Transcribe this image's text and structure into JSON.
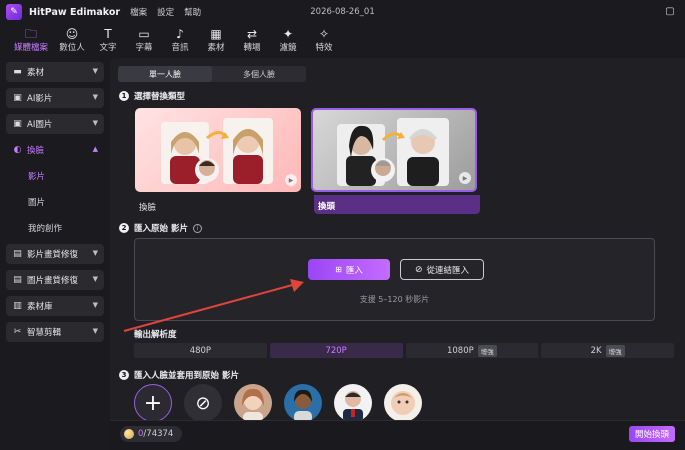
{
  "titlebar": {
    "app_title": "HitPaw Edimakor",
    "menus": [
      "檔案",
      "設定",
      "幫助"
    ],
    "doc_title": "2026-08-26_01"
  },
  "toolbar": {
    "tools": [
      {
        "label": "媒體檔案",
        "icon": "media-icon"
      },
      {
        "label": "數位人",
        "icon": "avatar-person-icon"
      },
      {
        "label": "文字",
        "icon": "text-icon"
      },
      {
        "label": "字幕",
        "icon": "subtitle-icon"
      },
      {
        "label": "音訊",
        "icon": "music-icon"
      },
      {
        "label": "素材",
        "icon": "grid-icon"
      },
      {
        "label": "轉場",
        "icon": "transition-icon"
      },
      {
        "label": "濾鏡",
        "icon": "sparkle-icon"
      },
      {
        "label": "特效",
        "icon": "effects-icon"
      }
    ]
  },
  "sidebar": {
    "items": [
      {
        "label": "素材",
        "icon": "folder-icon"
      },
      {
        "label": "AI影片",
        "icon": "ai-video-icon"
      },
      {
        "label": "AI圖片",
        "icon": "ai-image-icon"
      },
      {
        "label": "換臉",
        "icon": "face-swap-icon"
      },
      {
        "label": "影片畫質修復",
        "icon": "video-enhance-icon"
      },
      {
        "label": "圖片畫質修復",
        "icon": "image-enhance-icon"
      },
      {
        "label": "素材庫",
        "icon": "library-icon"
      },
      {
        "label": "智慧剪輯",
        "icon": "smart-cut-icon"
      }
    ],
    "sub_items": [
      "影片",
      "圖片",
      "我的創作"
    ]
  },
  "main": {
    "tabs": [
      "單一人臉",
      "多個人臉"
    ],
    "step1": {
      "num": "1",
      "title": "選擇替換類型"
    },
    "cards": [
      {
        "label": "換臉"
      },
      {
        "label": "換頭"
      }
    ],
    "step2": {
      "num": "2",
      "title": "匯入原始 影片",
      "info": "i"
    },
    "upload": {
      "import_label": "匯入",
      "link_label": "從連結匯入",
      "hint": "支援 5–120 秒影片"
    },
    "resolution": {
      "title": "輸出解析度",
      "options": [
        {
          "label": "480P",
          "tag": ""
        },
        {
          "label": "720P",
          "tag": ""
        },
        {
          "label": "1080P",
          "tag": "增強"
        },
        {
          "label": "2K",
          "tag": "增強"
        }
      ]
    },
    "step3": {
      "num": "3",
      "title": "匯入人臉並套用到原始 影片"
    },
    "faces": {
      "add_symbol": "+",
      "none_symbol": "⊘"
    }
  },
  "bottom": {
    "credits_used": "0",
    "credits_total": "/74374",
    "start_label": "開始換頭"
  },
  "colors": {
    "accent": "#c77dff",
    "button_gradient_start": "#9b46f5",
    "button_gradient_end": "#c46bff",
    "background": "#1b1b1f",
    "annotation_arrow": "#e0443a"
  }
}
